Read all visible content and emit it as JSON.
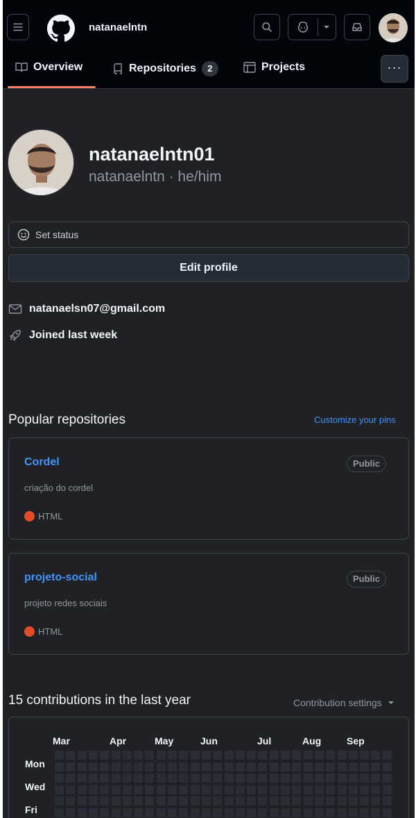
{
  "header": {
    "username": "natanaelntn",
    "copilot_label": "copilot-icon",
    "inbox_label": "inbox-icon"
  },
  "tabs": [
    {
      "label": "Overview",
      "icon": "book-icon",
      "selected": true
    },
    {
      "label": "Repositories",
      "icon": "repo-icon",
      "count": "2"
    },
    {
      "label": "Projects",
      "icon": "table-icon"
    }
  ],
  "more_label": "···",
  "profile": {
    "display_name": "natanaelntn01",
    "handle": "natanaelntn · he/him",
    "set_status": "Set status",
    "edit_profile": "Edit profile",
    "email": "natanaelsn07@gmail.com",
    "joined": "Joined last week"
  },
  "popular": {
    "title": "Popular repositories",
    "customize": "Customize your pins",
    "repos": [
      {
        "name": "Cordel",
        "visibility": "Public",
        "description": "criação do cordel",
        "language": "HTML",
        "language_color": "#e34c26"
      },
      {
        "name": "projeto-social",
        "visibility": "Public",
        "description": "projeto redes sociais",
        "language": "HTML",
        "language_color": "#e34c26"
      }
    ]
  },
  "contributions": {
    "title": "15 contributions in the last year",
    "settings": "Contribution settings",
    "months": [
      "Mar",
      "Apr",
      "May",
      "Jun",
      "Jul",
      "Aug",
      "Sep"
    ],
    "days": [
      "Mon",
      "Wed",
      "Fri"
    ]
  },
  "colors": {
    "background": "#1f2125",
    "link": "#4493f8",
    "tab_underline": "#f78166",
    "html_language": "#e34c26"
  }
}
